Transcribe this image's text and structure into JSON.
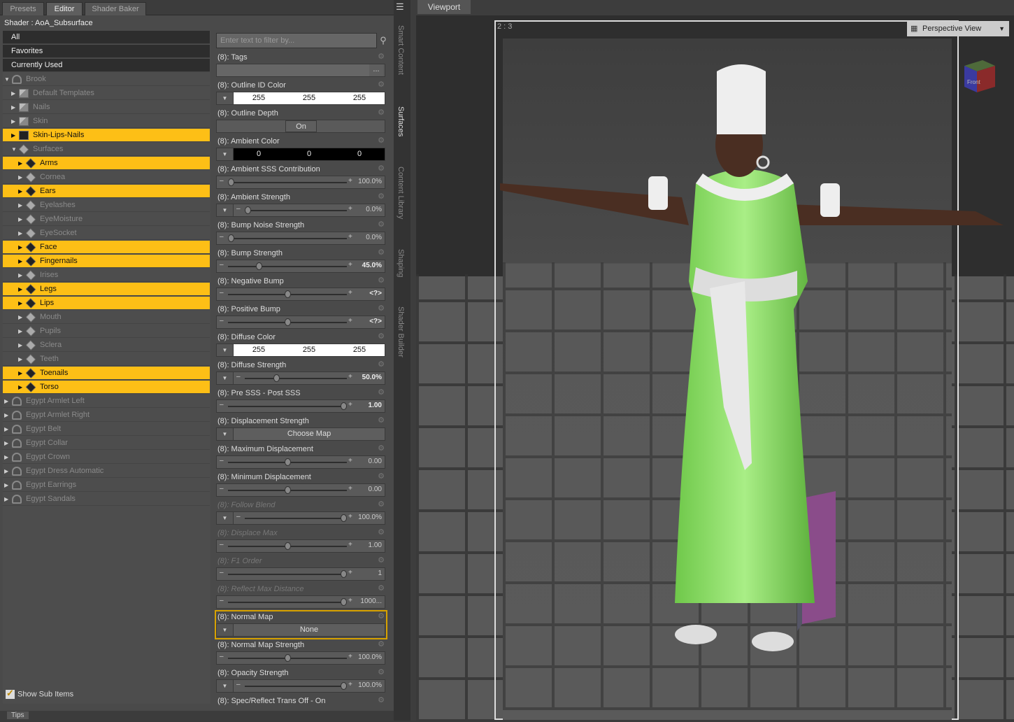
{
  "tabs": [
    "Presets",
    "Editor",
    "Shader Baker"
  ],
  "shader_title": "Shader : AoA_Subsurface",
  "tree": [
    {
      "label": "All",
      "type": "top",
      "indent": 0
    },
    {
      "label": "Favorites",
      "type": "top",
      "indent": 0
    },
    {
      "label": "Currently Used",
      "type": "top",
      "indent": 0
    },
    {
      "label": "Brook",
      "type": "fig",
      "indent": 0,
      "open": true,
      "hl": false
    },
    {
      "label": "Default Templates",
      "type": "fold",
      "indent": 1,
      "hl": false
    },
    {
      "label": "Nails",
      "type": "fold",
      "indent": 1,
      "hl": false
    },
    {
      "label": "Skin",
      "type": "fold",
      "indent": 1,
      "hl": false
    },
    {
      "label": "Skin-Lips-Nails",
      "type": "fold",
      "indent": 1,
      "hl": true
    },
    {
      "label": "Surfaces",
      "type": "mat",
      "indent": 1,
      "open": true,
      "hl": false
    },
    {
      "label": "Arms",
      "type": "mat",
      "indent": 2,
      "hl": true
    },
    {
      "label": "Cornea",
      "type": "mat",
      "indent": 2,
      "hl": false
    },
    {
      "label": "Ears",
      "type": "mat",
      "indent": 2,
      "hl": true
    },
    {
      "label": "Eyelashes",
      "type": "mat",
      "indent": 2,
      "hl": false
    },
    {
      "label": "EyeMoisture",
      "type": "mat",
      "indent": 2,
      "hl": false
    },
    {
      "label": "EyeSocket",
      "type": "mat",
      "indent": 2,
      "hl": false
    },
    {
      "label": "Face",
      "type": "mat",
      "indent": 2,
      "hl": true
    },
    {
      "label": "Fingernails",
      "type": "mat",
      "indent": 2,
      "hl": true
    },
    {
      "label": "Irises",
      "type": "mat",
      "indent": 2,
      "hl": false
    },
    {
      "label": "Legs",
      "type": "mat",
      "indent": 2,
      "hl": true
    },
    {
      "label": "Lips",
      "type": "mat",
      "indent": 2,
      "hl": true
    },
    {
      "label": "Mouth",
      "type": "mat",
      "indent": 2,
      "hl": false
    },
    {
      "label": "Pupils",
      "type": "mat",
      "indent": 2,
      "hl": false
    },
    {
      "label": "Sclera",
      "type": "mat",
      "indent": 2,
      "hl": false
    },
    {
      "label": "Teeth",
      "type": "mat",
      "indent": 2,
      "hl": false
    },
    {
      "label": "Toenails",
      "type": "mat",
      "indent": 2,
      "hl": true
    },
    {
      "label": "Torso",
      "type": "mat",
      "indent": 2,
      "hl": true
    },
    {
      "label": "Egypt Armlet Left",
      "type": "fig",
      "indent": 0,
      "hl": false
    },
    {
      "label": "Egypt Armlet Right",
      "type": "fig",
      "indent": 0,
      "hl": false
    },
    {
      "label": "Egypt Belt",
      "type": "fig",
      "indent": 0,
      "hl": false
    },
    {
      "label": "Egypt Collar",
      "type": "fig",
      "indent": 0,
      "hl": false
    },
    {
      "label": "Egypt Crown",
      "type": "fig",
      "indent": 0,
      "hl": false
    },
    {
      "label": "Egypt Dress Automatic",
      "type": "fig",
      "indent": 0,
      "hl": false
    },
    {
      "label": "Egypt Earrings",
      "type": "fig",
      "indent": 0,
      "hl": false
    },
    {
      "label": "Egypt Sandals",
      "type": "fig",
      "indent": 0,
      "hl": false
    }
  ],
  "show_sub_items": "Show Sub Items",
  "filter_placeholder": "Enter text to filter by...",
  "properties": [
    {
      "label": "(8): Tags",
      "kind": "tags",
      "tags_button": "..."
    },
    {
      "label": "(8): Outline ID Color",
      "kind": "color",
      "color": "white",
      "values": [
        "255",
        "255",
        "255"
      ]
    },
    {
      "label": "(8): Outline Depth",
      "kind": "toggle",
      "value": "On"
    },
    {
      "label": "(8): Ambient Color",
      "kind": "color",
      "color": "black",
      "values": [
        "0",
        "0",
        "0"
      ]
    },
    {
      "label": "(8): Ambient SSS Contribution",
      "kind": "slider",
      "level": 0,
      "value": "100.0%",
      "dd": false
    },
    {
      "label": "(8): Ambient Strength",
      "kind": "slider",
      "level": 0,
      "value": "0.0%",
      "dd": true
    },
    {
      "label": "(8): Bump Noise Strength",
      "kind": "slider",
      "level": 0,
      "value": "0.0%",
      "dd": false
    },
    {
      "label": "(8): Bump Strength",
      "kind": "slider",
      "level": 0.25,
      "value": "45.0%",
      "dd": false,
      "bold": true
    },
    {
      "label": "(8): Negative Bump",
      "kind": "slider",
      "level": 0.5,
      "value": "<?>",
      "dd": false,
      "bold": true
    },
    {
      "label": "(8): Positive Bump",
      "kind": "slider",
      "level": 0.5,
      "value": "<?>",
      "dd": false,
      "bold": true
    },
    {
      "label": "(8): Diffuse Color",
      "kind": "color",
      "color": "white",
      "values": [
        "255",
        "255",
        "255"
      ]
    },
    {
      "label": "(8): Diffuse Strength",
      "kind": "slider",
      "level": 0.3,
      "value": "50.0%",
      "dd": true,
      "bold": true
    },
    {
      "label": "(8): Pre SSS - Post SSS",
      "kind": "slider",
      "level": 1,
      "value": "1.00",
      "dd": false,
      "bold": true
    },
    {
      "label": "(8): Displacement Strength",
      "kind": "button",
      "value": "Choose Map"
    },
    {
      "label": "(8): Maximum Displacement",
      "kind": "slider",
      "level": 0.5,
      "value": "0.00",
      "dd": false
    },
    {
      "label": "(8): Minimum Displacement",
      "kind": "slider",
      "level": 0.5,
      "value": "0.00",
      "dd": false
    },
    {
      "label": "(8): Follow Blend",
      "kind": "slider",
      "level": 1,
      "value": "100.0%",
      "dd": true,
      "dim": true
    },
    {
      "label": "(8): Displace Max",
      "kind": "slider",
      "level": 0.5,
      "value": "1.00",
      "dd": false,
      "dim": true
    },
    {
      "label": "(8): F1 Order",
      "kind": "slider",
      "level": 1,
      "value": "1",
      "dd": false,
      "dim": true
    },
    {
      "label": "(8): Reflect Max Distance",
      "kind": "slider",
      "level": 1,
      "value": "1000...",
      "dd": false,
      "dim": true
    },
    {
      "label": "(8): Normal Map",
      "kind": "button",
      "value": "None",
      "selected": true
    },
    {
      "label": "(8): Normal Map Strength",
      "kind": "slider",
      "level": 0.5,
      "value": "100.0%",
      "dd": false
    },
    {
      "label": "(8): Opacity Strength",
      "kind": "slider",
      "level": 1,
      "value": "100.0%",
      "dd": true
    },
    {
      "label": "(8): Spec/Reflect Trans Off - On",
      "kind": "header"
    }
  ],
  "side_tabs": [
    "Smart Content",
    "Surfaces",
    "Content Library",
    "Shaping",
    "Shader Builder"
  ],
  "tips_tab": "Tips",
  "viewport": {
    "tab": "Viewport",
    "ratio": "2 : 3",
    "view_mode": "Perspective View",
    "nav_cube_label": "Front"
  }
}
